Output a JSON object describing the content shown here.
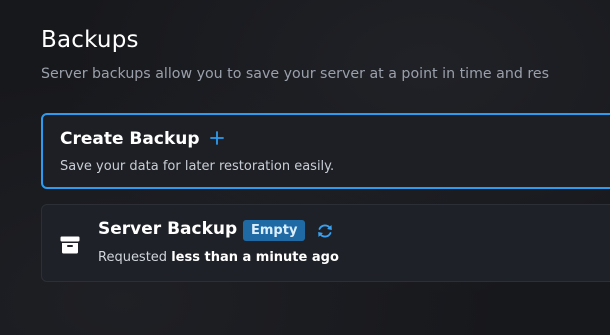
{
  "header": {
    "title": "Backups",
    "description": "Server backups allow you to save your server at a point in time and res"
  },
  "create_backup": {
    "title": "Create Backup",
    "icon": "plus-icon",
    "description": "Save your data for later restoration easily."
  },
  "backups": [
    {
      "name": "Server Backup",
      "icon": "archive-icon",
      "status": "Empty",
      "status_icon": "refresh-icon",
      "requested_prefix": "Requested",
      "requested_time": "less than a minute ago"
    }
  ],
  "colors": {
    "accent": "#2d9cf0",
    "badge_bg": "#1f6aa5",
    "background": "#17181c",
    "card_bg": "#1e2127"
  }
}
